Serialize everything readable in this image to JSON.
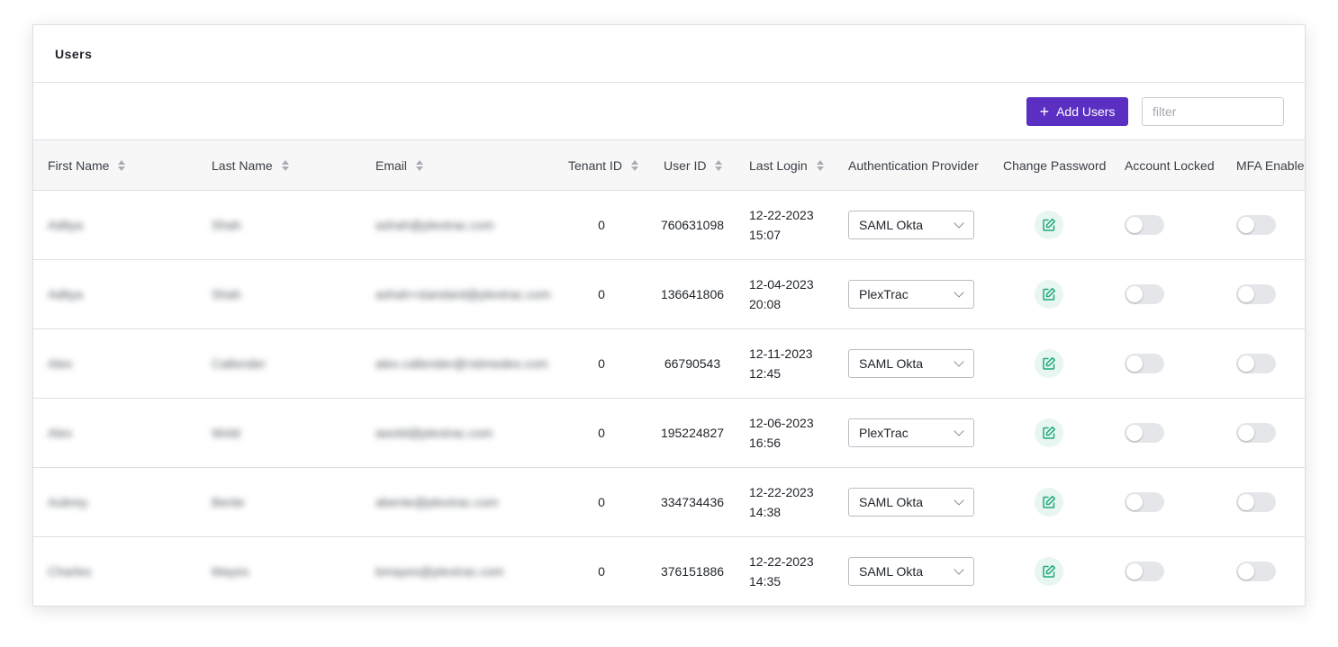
{
  "page": {
    "title": "Users"
  },
  "toolbar": {
    "add_label": "Add Users",
    "filter_placeholder": "filter"
  },
  "columns": [
    {
      "label": "First Name",
      "sortable": true
    },
    {
      "label": "Last Name",
      "sortable": true
    },
    {
      "label": "Email",
      "sortable": true
    },
    {
      "label": "Tenant ID",
      "sortable": true
    },
    {
      "label": "User ID",
      "sortable": true
    },
    {
      "label": "Last Login",
      "sortable": true
    },
    {
      "label": "Authentication Provider",
      "sortable": false
    },
    {
      "label": "Change Password",
      "sortable": false
    },
    {
      "label": "Account Locked",
      "sortable": false
    },
    {
      "label": "MFA Enabled",
      "sortable": false
    }
  ],
  "rows": [
    {
      "first": "Aditya",
      "last": "Shah",
      "email": "ashah@plextrac.com",
      "tenant": "0",
      "user_id": "760631098",
      "login_date": "12-22-2023",
      "login_time": "15:07",
      "provider": "SAML Okta",
      "locked": false,
      "mfa": false
    },
    {
      "first": "Aditya",
      "last": "Shah",
      "email": "ashah+standard@plextrac.com",
      "tenant": "0",
      "user_id": "136641806",
      "login_date": "12-04-2023",
      "login_time": "20:08",
      "provider": "PlexTrac",
      "locked": false,
      "mfa": false
    },
    {
      "first": "Alex",
      "last": "Callender",
      "email": "alex.callender@rstimedes.com",
      "tenant": "0",
      "user_id": "66790543",
      "login_date": "12-11-2023",
      "login_time": "12:45",
      "provider": "SAML Okta",
      "locked": false,
      "mfa": false
    },
    {
      "first": "Alex",
      "last": "Wold",
      "email": "awold@plextrac.com",
      "tenant": "0",
      "user_id": "195224827",
      "login_date": "12-06-2023",
      "login_time": "16:56",
      "provider": "PlexTrac",
      "locked": false,
      "mfa": false
    },
    {
      "first": "Aubrey",
      "last": "Bente",
      "email": "abente@plextrac.com",
      "tenant": "0",
      "user_id": "334734436",
      "login_date": "12-22-2023",
      "login_time": "14:38",
      "provider": "SAML Okta",
      "locked": false,
      "mfa": false
    },
    {
      "first": "Charles",
      "last": "Mayes",
      "email": "bmayes@plextrac.com",
      "tenant": "0",
      "user_id": "376151886",
      "login_date": "12-22-2023",
      "login_time": "14:35",
      "provider": "SAML Okta",
      "locked": false,
      "mfa": false
    }
  ],
  "icons": {
    "add": "plus-icon",
    "sort": "sort-icon",
    "edit": "edit-icon",
    "dropdown": "chevron-down-icon"
  },
  "colors": {
    "primary": "#5a2fc2",
    "edit_accent": "#1fa97d",
    "edit_bg": "#e8f6f1",
    "toggle_off": "#e4e6e9"
  }
}
